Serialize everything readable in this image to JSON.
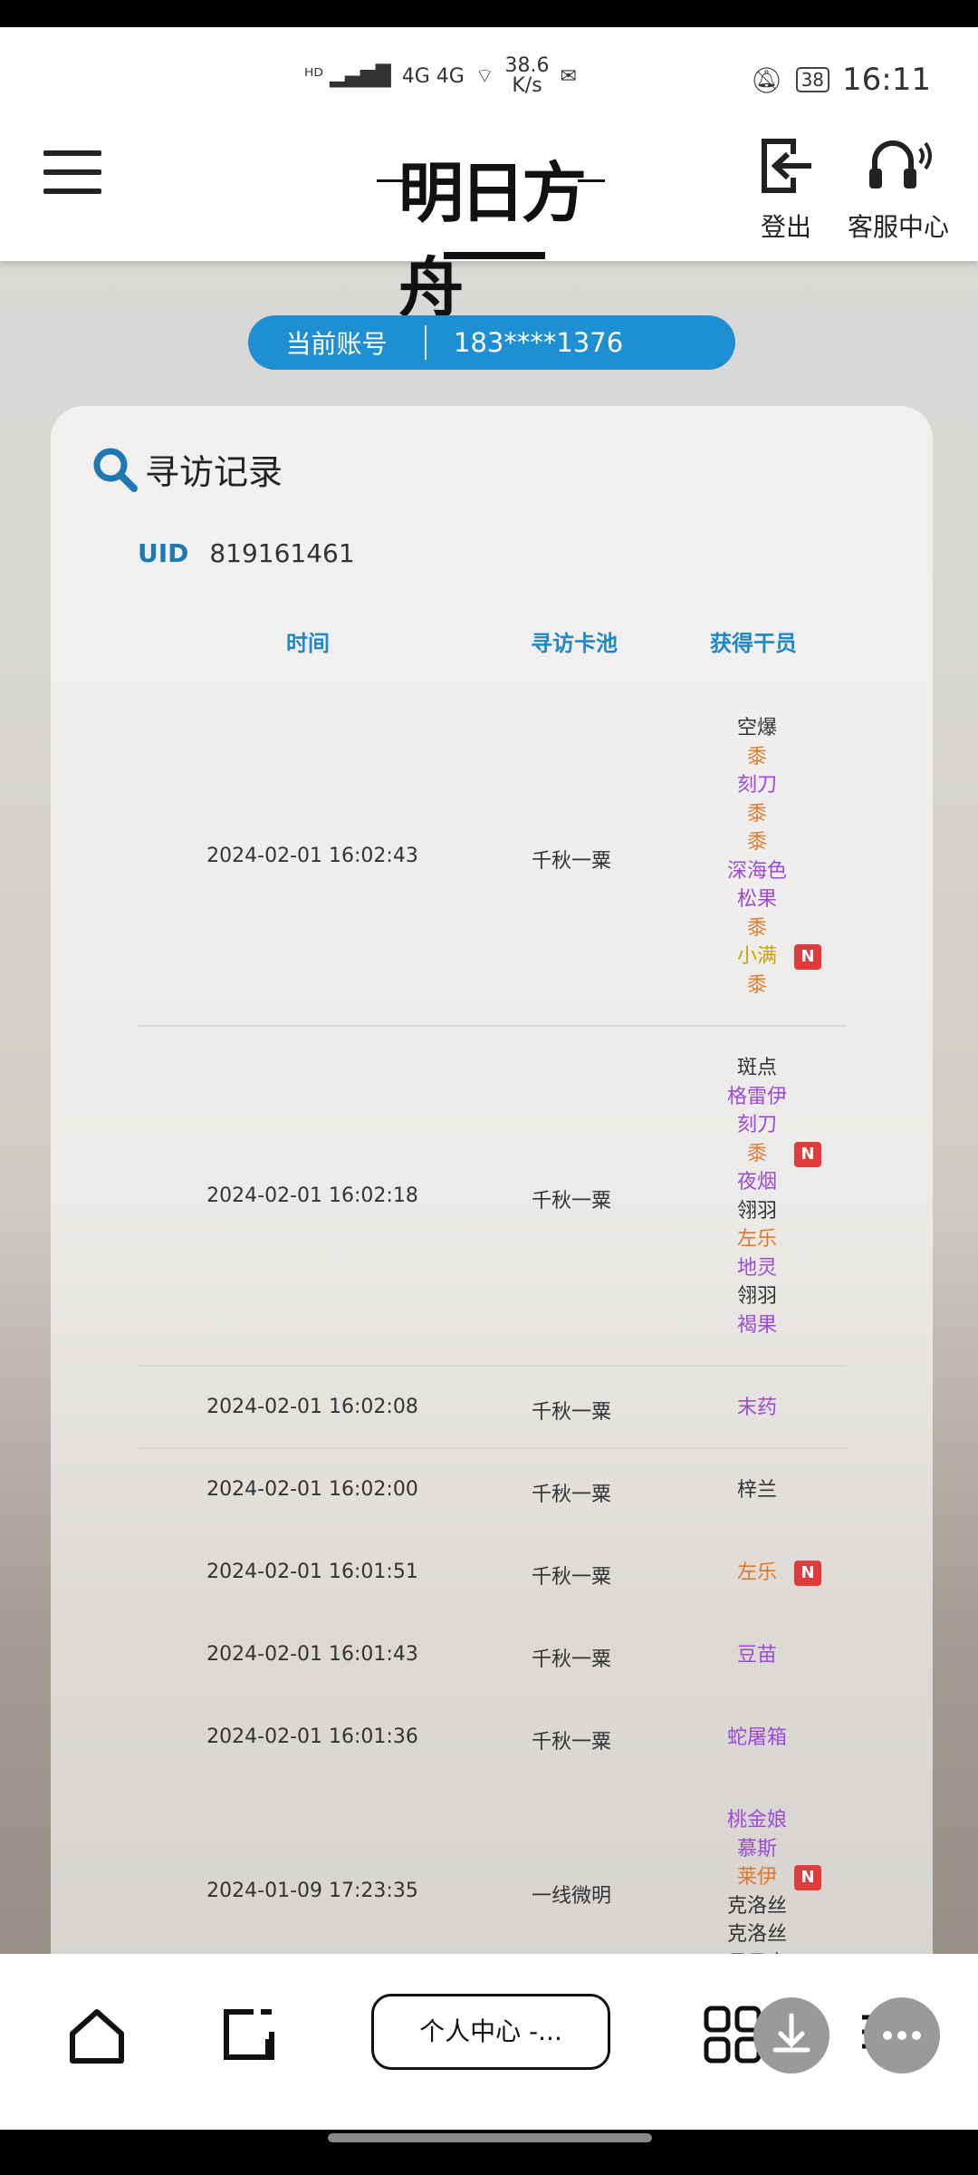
{
  "status": {
    "signal_text": "4G 4G",
    "speed": "38.6",
    "speed_unit": "K/s",
    "battery": "38",
    "time": "16:11"
  },
  "header": {
    "logo_text": "明日方舟",
    "logout_label": "登出",
    "service_label": "客服中心"
  },
  "account": {
    "label": "当前账号",
    "value": "183****1376"
  },
  "record": {
    "title": "寻访记录",
    "uid_label": "UID",
    "uid_value": "819161461",
    "col_time": "时间",
    "col_pool": "寻访卡池",
    "col_ops": "获得干员"
  },
  "rows": [
    {
      "time": "2024-02-01 16:02:43",
      "pool": "千秋一粟",
      "ops": [
        {
          "name": "空爆",
          "rarity": "3",
          "new": false
        },
        {
          "name": "黍",
          "rarity": "6",
          "new": false
        },
        {
          "name": "刻刀",
          "rarity": "4",
          "new": false
        },
        {
          "name": "黍",
          "rarity": "6",
          "new": false
        },
        {
          "name": "黍",
          "rarity": "6",
          "new": false
        },
        {
          "name": "深海色",
          "rarity": "4",
          "new": false
        },
        {
          "name": "松果",
          "rarity": "4",
          "new": false
        },
        {
          "name": "黍",
          "rarity": "6",
          "new": false
        },
        {
          "name": "小满",
          "rarity": "5",
          "new": true
        },
        {
          "name": "黍",
          "rarity": "6",
          "new": false
        }
      ]
    },
    {
      "time": "2024-02-01 16:02:18",
      "pool": "千秋一粟",
      "ops": [
        {
          "name": "斑点",
          "rarity": "3",
          "new": false
        },
        {
          "name": "格雷伊",
          "rarity": "4",
          "new": false
        },
        {
          "name": "刻刀",
          "rarity": "4",
          "new": false
        },
        {
          "name": "黍",
          "rarity": "6",
          "new": true
        },
        {
          "name": "夜烟",
          "rarity": "4",
          "new": false
        },
        {
          "name": "翎羽",
          "rarity": "3",
          "new": false
        },
        {
          "name": "左乐",
          "rarity": "6",
          "new": false
        },
        {
          "name": "地灵",
          "rarity": "4",
          "new": false
        },
        {
          "name": "翎羽",
          "rarity": "3",
          "new": false
        },
        {
          "name": "褐果",
          "rarity": "4",
          "new": false
        }
      ]
    },
    {
      "time": "2024-02-01 16:02:08",
      "pool": "千秋一粟",
      "ops": [
        {
          "name": "末药",
          "rarity": "4",
          "new": false
        }
      ]
    },
    {
      "time": "2024-02-01 16:02:00",
      "pool": "千秋一粟",
      "ops": [
        {
          "name": "梓兰",
          "rarity": "3",
          "new": false
        }
      ]
    },
    {
      "time": "2024-02-01 16:01:51",
      "pool": "千秋一粟",
      "ops": [
        {
          "name": "左乐",
          "rarity": "6",
          "new": true
        }
      ]
    },
    {
      "time": "2024-02-01 16:01:43",
      "pool": "千秋一粟",
      "ops": [
        {
          "name": "豆苗",
          "rarity": "4",
          "new": false
        }
      ]
    },
    {
      "time": "2024-02-01 16:01:36",
      "pool": "千秋一粟",
      "ops": [
        {
          "name": "蛇屠箱",
          "rarity": "4",
          "new": false
        }
      ]
    },
    {
      "time": "2024-01-09 17:23:35",
      "pool": "一线微明",
      "ops": [
        {
          "name": "桃金娘",
          "rarity": "4",
          "new": false
        },
        {
          "name": "慕斯",
          "rarity": "4",
          "new": false
        },
        {
          "name": "莱伊",
          "rarity": "6",
          "new": true
        },
        {
          "name": "克洛丝",
          "rarity": "3",
          "new": false
        },
        {
          "name": "克洛丝",
          "rarity": "3",
          "new": false
        },
        {
          "name": "月见夜",
          "rarity": "3",
          "new": false
        }
      ]
    }
  ],
  "new_badge": "N",
  "rarity_colors": {
    "3": "#333333",
    "4": "#9b4bd6",
    "5": "#c8a400",
    "6": "#e0782a"
  },
  "bottom": {
    "tab_label": "个人中心 -..."
  }
}
